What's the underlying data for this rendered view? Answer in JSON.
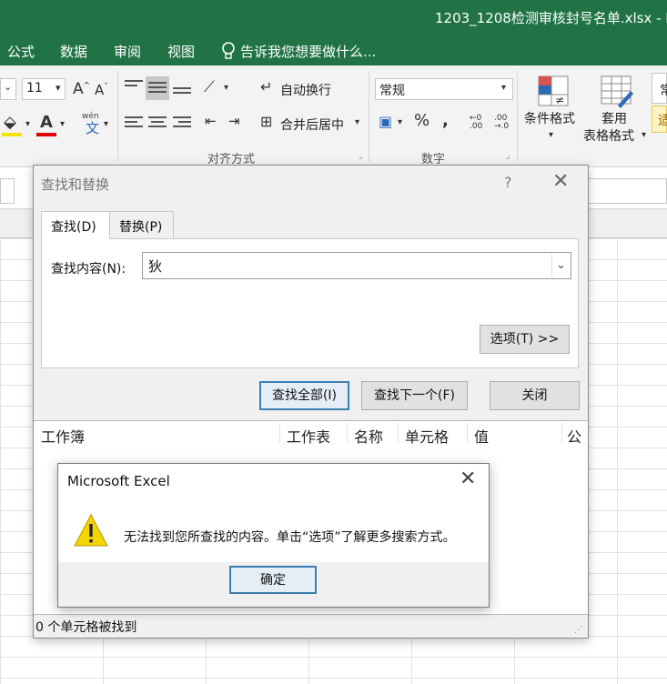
{
  "window": {
    "title": "1203_1208检测审核封号名单.xlsx - Ex"
  },
  "menu": {
    "items": [
      "公式",
      "数据",
      "审阅",
      "视图"
    ],
    "tell_me": "告诉我您想要做什么..."
  },
  "ribbon": {
    "font_size": "11",
    "wrap_text": "自动换行",
    "merge_center": "合并后居中",
    "number_format": "常规",
    "conditional_format": "条件格式",
    "table_format_line1": "套用",
    "table_format_line2": "表格格式",
    "style_partial": "常",
    "style_partial2": "适",
    "group_alignment": "对齐方式",
    "group_number": "数字",
    "percent": "%",
    "comma": ",",
    "inc_decimal": ".00\n→.0",
    "wen": "wén",
    "wen_char": "文"
  },
  "find_dialog": {
    "title": "查找和替换",
    "help": "?",
    "tab_find": "查找(D)",
    "tab_replace": "替换(P)",
    "find_label": "查找内容(N):",
    "find_value": "狄",
    "options_button": "选项(T) >>",
    "find_all_button": "查找全部(I)",
    "find_next_button": "查找下一个(F)",
    "close_button": "关闭",
    "columns": [
      "工作簿",
      "工作表",
      "名称",
      "单元格",
      "值",
      "公"
    ],
    "status": "0 个单元格被找到"
  },
  "message_box": {
    "title": "Microsoft Excel",
    "message": "无法找到您所查找的内容。单击“选项”了解更多搜索方式。",
    "ok_button": "确定"
  },
  "colors": {
    "excel_green": "#217346",
    "warning_yellow": "#f5d400",
    "default_button_border": "#3c7fb1"
  }
}
